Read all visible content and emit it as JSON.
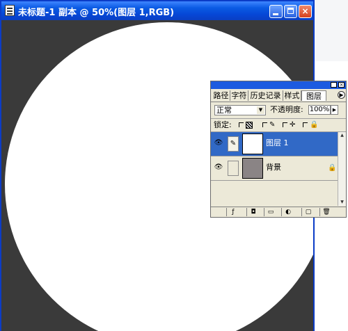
{
  "window": {
    "title": "未标题-1 副本 @ 50%(图层 1,RGB)",
    "buttons": {
      "minimize": "minimize",
      "maximize": "maximize",
      "close": "×"
    }
  },
  "colors": {
    "titlebar": "#0a5ae3",
    "canvas_bg": "#3a3a3a",
    "selected_layer": "#3169c6"
  },
  "palette": {
    "tabs": [
      "路径",
      "字符",
      "历史记录",
      "样式",
      "图层"
    ],
    "active_tab": "图层",
    "blend_mode": "正常",
    "opacity_label": "不透明度:",
    "opacity_value": "100%",
    "lock_label": "锁定:",
    "layers": [
      {
        "name": "图层 1",
        "selected": true,
        "visible": true
      },
      {
        "name": "背景",
        "selected": false,
        "visible": true,
        "locked": true
      }
    ],
    "icons": {
      "eye": "👁",
      "brush": "✎",
      "lock": "🔒",
      "scroll_up": "▲",
      "scroll_down": "▼",
      "tab_menu": "▶",
      "blend_arrow": "▼",
      "opacity_arrow": "▶",
      "lock_brush": "✎",
      "lock_move": "✛",
      "bottom": [
        "ƒ",
        "◘",
        "▭",
        "◐",
        "▢",
        "🗑"
      ]
    }
  }
}
